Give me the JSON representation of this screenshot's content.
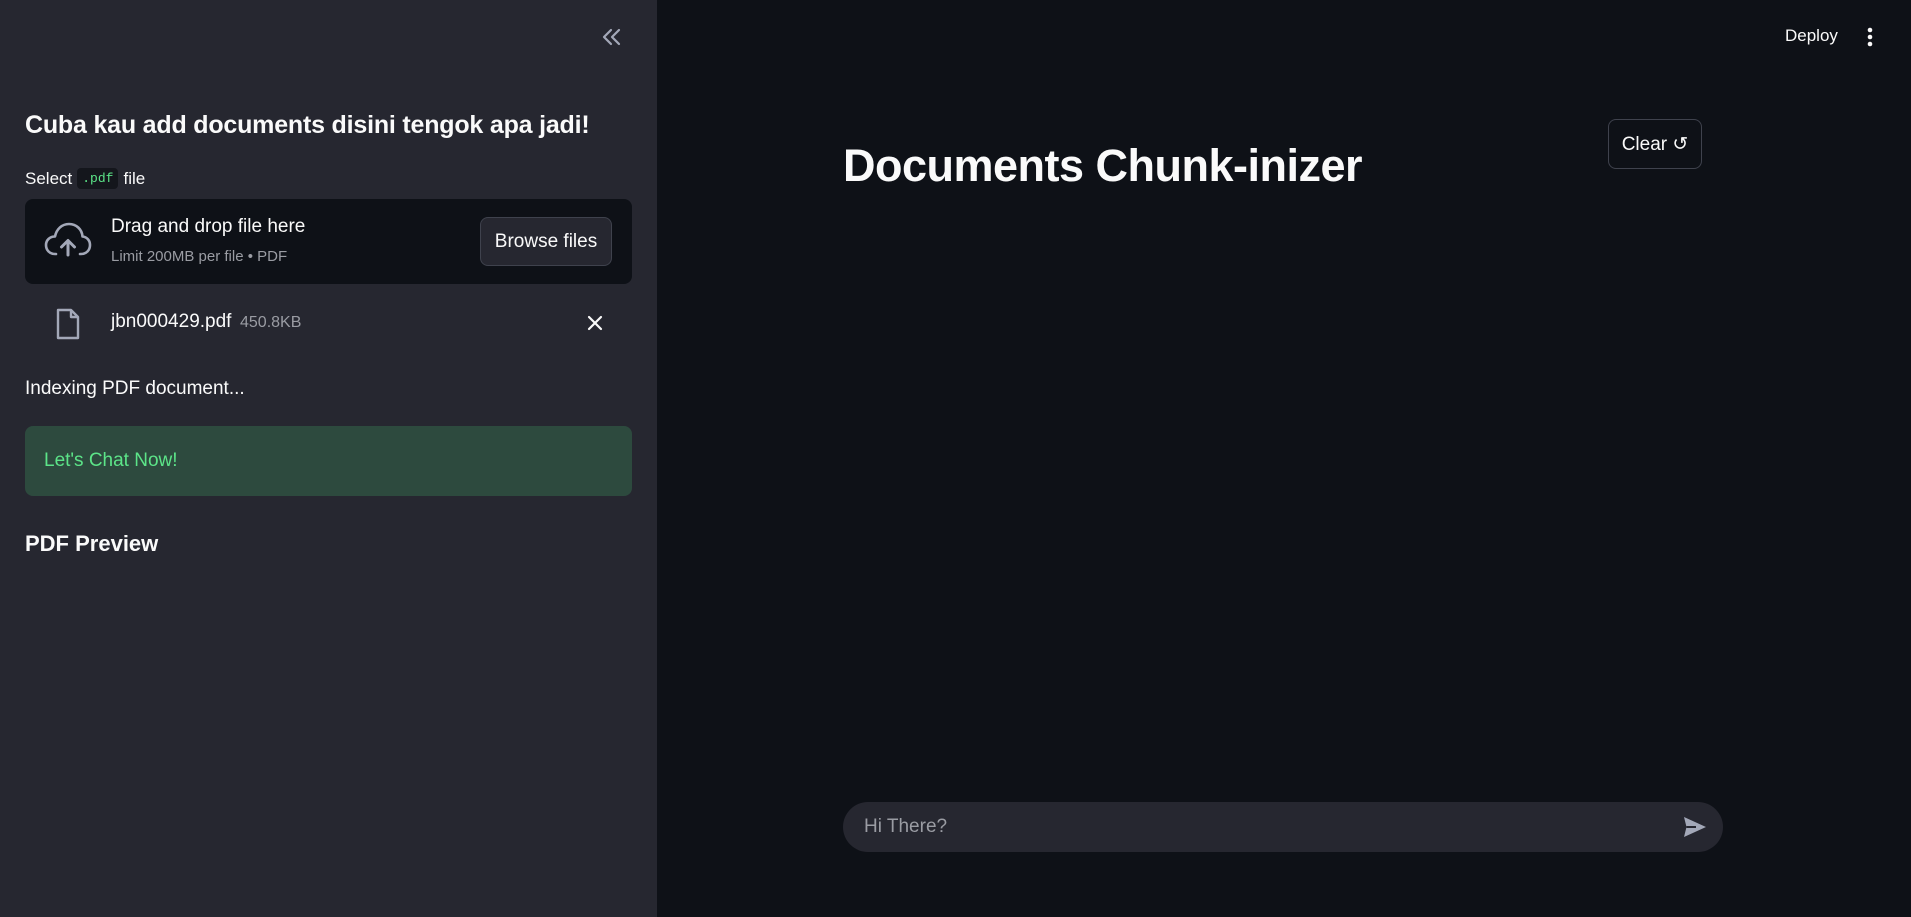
{
  "sidebar": {
    "collapse_icon": "chevrons-left-icon",
    "heading": "Cuba kau add documents disini tengok apa jadi!",
    "select_label_before": "Select",
    "select_label_code": ".pdf",
    "select_label_after": "file",
    "uploader": {
      "icon": "cloud-upload-icon",
      "title": "Drag and drop file here",
      "subtitle": "Limit 200MB per file • PDF",
      "browse_label": "Browse files"
    },
    "uploaded_file": {
      "icon": "file-icon",
      "name": "jbn000429.pdf",
      "size": "450.8KB",
      "remove_icon": "close-icon"
    },
    "status_text": "Indexing PDF document...",
    "success_message": "Let's Chat Now!",
    "preview_heading": "PDF Preview"
  },
  "toolbar": {
    "deploy_label": "Deploy",
    "menu_icon": "more-vertical-icon"
  },
  "main": {
    "title": "Documents Chunk-inizer",
    "clear_label": "Clear ↺"
  },
  "chat": {
    "placeholder": "Hi There?",
    "send_icon": "send-icon"
  },
  "colors": {
    "main_bg": "#0e1117",
    "sidebar_bg": "#262730",
    "success_bg": "#2d4a3e",
    "success_text": "#5ce488"
  }
}
